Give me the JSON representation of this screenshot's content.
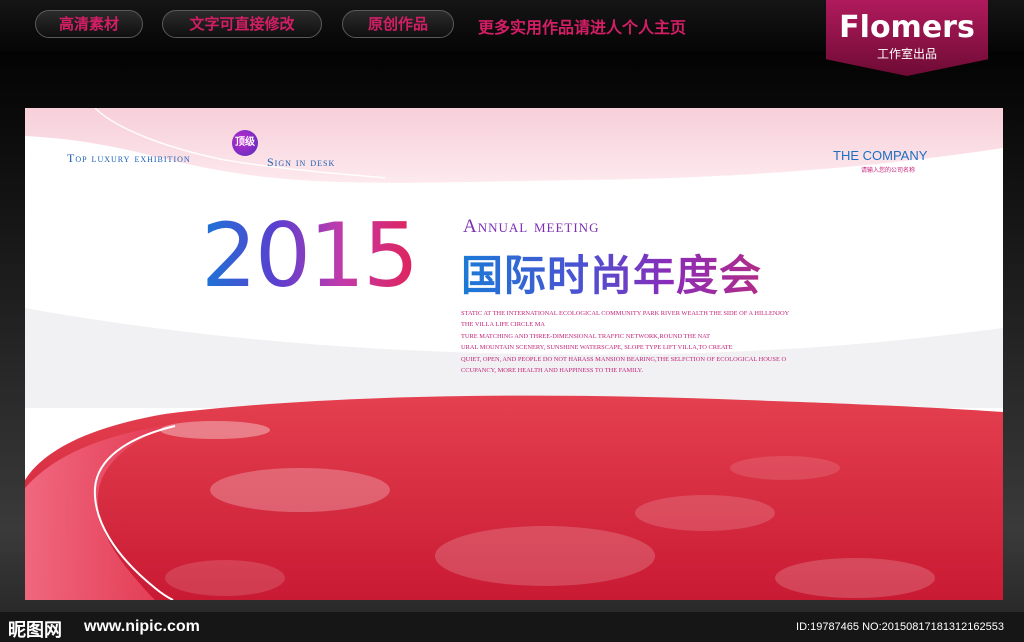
{
  "top_bar": {
    "pills": [
      "高清素材",
      "文字可直接修改",
      "原创作品"
    ],
    "promo": "更多实用作品请进人个人主页",
    "brand_name": "Flomers",
    "brand_sub": "工作室出品"
  },
  "banner": {
    "tag_left_1": "Top luxury exhibition",
    "tag_badge": "顶级",
    "tag_left_2": "Sign in desk",
    "company": "THE COMPANY",
    "company_sub": "请输入您的公司名称",
    "year": "2015",
    "annual": "Annual meeting",
    "title_cn": "国际时尚年度会",
    "desc_lines": [
      "STATIC AT THE INTERNATIONAL ECOLOGICAL COMMUNITY PARK RIVER WEALTH THE SIDE OF A HILLENJOY",
      "THE VILLA LIFE CIRCLE MA",
      "TURE MATCHING AND THREE-DIMENSIONAL TRAFFIC NETWORK,ROUND THE NAT",
      "URAL MOUNTAIN SCENERY, SUNSHINE WATERSCAPE, SLOPE TYPE LIFT VILLA,TO CREATE",
      "QUIET, OPEN, AND PEOPLE DO NOT HARASS MANSION BEARING,THE SELFCTION OF ECOLOGICAL HOUSE O",
      "CCUPANCY, MORE HEALTH AND HAPPINESS TO THE FAMILY."
    ]
  },
  "watermark": {
    "logo": "昵图网",
    "url": "www.nipic.com",
    "id": "ID:19787465 NO:20150817181312162553"
  },
  "colors": {
    "accent": "#d31e66",
    "brand_bg": "#9c1650",
    "floor_red": "#d8283c",
    "title_blue": "#1b76d6",
    "title_purple": "#8b2bb8"
  }
}
